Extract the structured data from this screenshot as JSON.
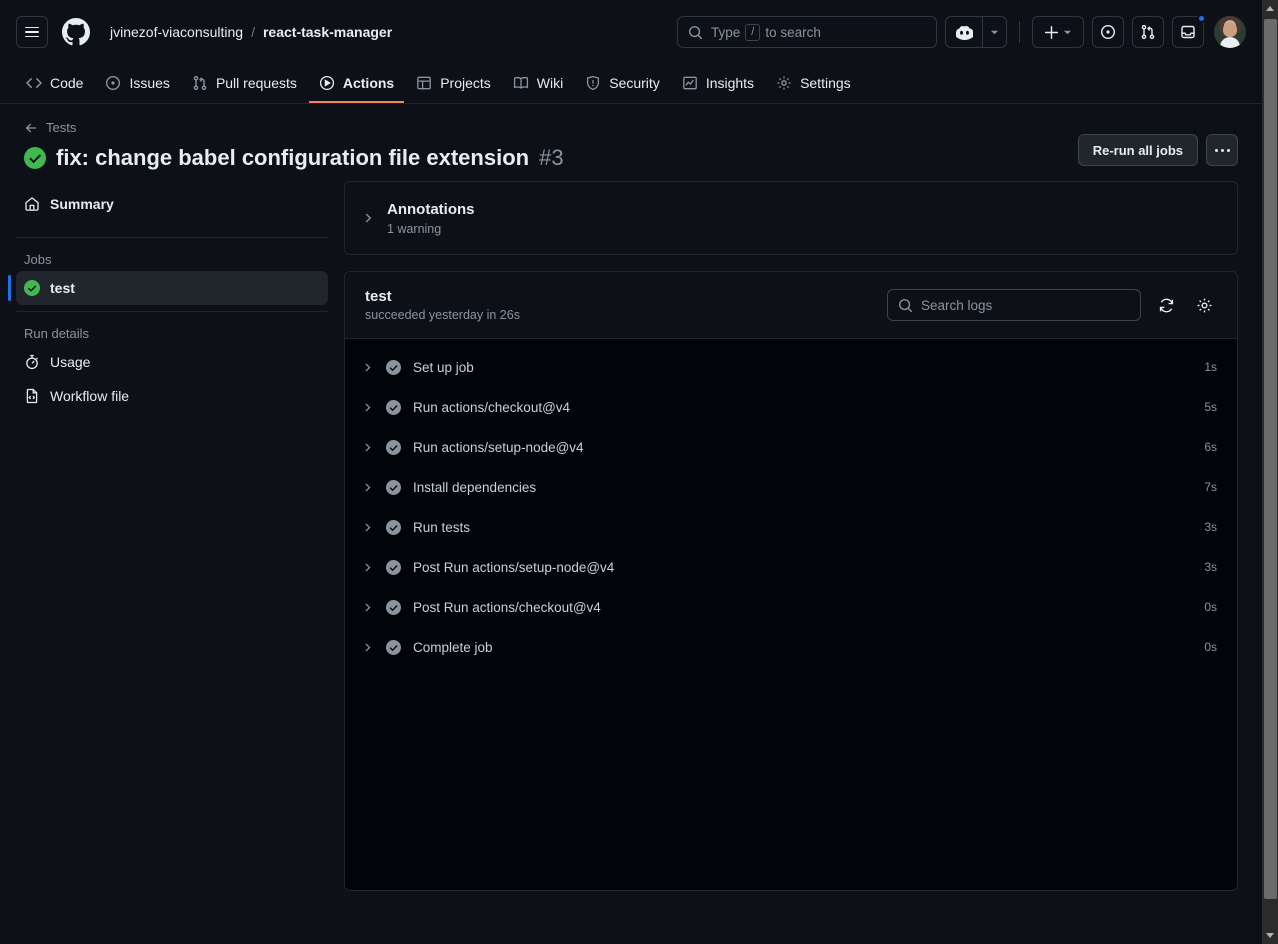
{
  "header": {
    "menu_icon": "hamburger-icon",
    "logo_icon": "github-logo-icon",
    "owner": "jvinezof-viaconsulting",
    "separator": "/",
    "repo": "react-task-manager",
    "search_placeholder": "Type",
    "search_key": "/",
    "search_suffix": "to search",
    "copilot_icon": "copilot-icon",
    "create_new_icon": "plus-icon",
    "issues_icon": "issue-opened-icon",
    "pull_requests_icon": "git-pull-request-icon",
    "notifications_icon": "inbox-icon",
    "avatar_icon": "user-avatar"
  },
  "repo_nav": {
    "items": [
      {
        "label": "Code",
        "icon": "code-icon",
        "active": false
      },
      {
        "label": "Issues",
        "icon": "issue-opened-icon",
        "active": false
      },
      {
        "label": "Pull requests",
        "icon": "git-pull-request-icon",
        "active": false
      },
      {
        "label": "Actions",
        "icon": "play-icon",
        "active": true
      },
      {
        "label": "Projects",
        "icon": "table-icon",
        "active": false
      },
      {
        "label": "Wiki",
        "icon": "book-icon",
        "active": false
      },
      {
        "label": "Security",
        "icon": "shield-icon",
        "active": false
      },
      {
        "label": "Insights",
        "icon": "graph-icon",
        "active": false
      },
      {
        "label": "Settings",
        "icon": "gear-icon",
        "active": false
      }
    ]
  },
  "run": {
    "back_label": "Tests",
    "status_icon": "check-circle-success-icon",
    "title": "fix: change babel configuration file extension",
    "number": "#3",
    "rerun_button": "Re-run all jobs",
    "kebab_label": "More options"
  },
  "sidebar": {
    "summary": {
      "label": "Summary",
      "icon": "home-icon"
    },
    "jobs_heading": "Jobs",
    "jobs": [
      {
        "label": "test",
        "status_icon": "check-circle-success-icon",
        "active": true
      }
    ],
    "run_details_heading": "Run details",
    "details": [
      {
        "label": "Usage",
        "icon": "stopwatch-icon"
      },
      {
        "label": "Workflow file",
        "icon": "file-code-icon"
      }
    ]
  },
  "annotations": {
    "chevron_icon": "chevron-right-icon",
    "title": "Annotations",
    "subtitle": "1 warning"
  },
  "job": {
    "name": "test",
    "status_line": "succeeded yesterday in 26s",
    "search_placeholder": "Search logs",
    "search_value": "",
    "refresh_icon": "sync-icon",
    "settings_icon": "gear-icon",
    "steps": [
      {
        "name": "Set up job",
        "duration": "1s",
        "status_icon": "check-circle-muted-icon"
      },
      {
        "name": "Run actions/checkout@v4",
        "duration": "5s",
        "status_icon": "check-circle-muted-icon"
      },
      {
        "name": "Run actions/setup-node@v4",
        "duration": "6s",
        "status_icon": "check-circle-muted-icon"
      },
      {
        "name": "Install dependencies",
        "duration": "7s",
        "status_icon": "check-circle-muted-icon"
      },
      {
        "name": "Run tests",
        "duration": "3s",
        "status_icon": "check-circle-muted-icon"
      },
      {
        "name": "Post Run actions/setup-node@v4",
        "duration": "3s",
        "status_icon": "check-circle-muted-icon"
      },
      {
        "name": "Post Run actions/checkout@v4",
        "duration": "0s",
        "status_icon": "check-circle-muted-icon"
      },
      {
        "name": "Complete job",
        "duration": "0s",
        "status_icon": "check-circle-muted-icon"
      }
    ]
  },
  "colors": {
    "page_bg": "#0d1117",
    "panel_bg": "#010409",
    "border": "#21262d",
    "accent_blue": "#1f6feb",
    "success_green": "#3fb950",
    "active_tab_underline": "#f78166",
    "muted_text": "#8b949e"
  }
}
